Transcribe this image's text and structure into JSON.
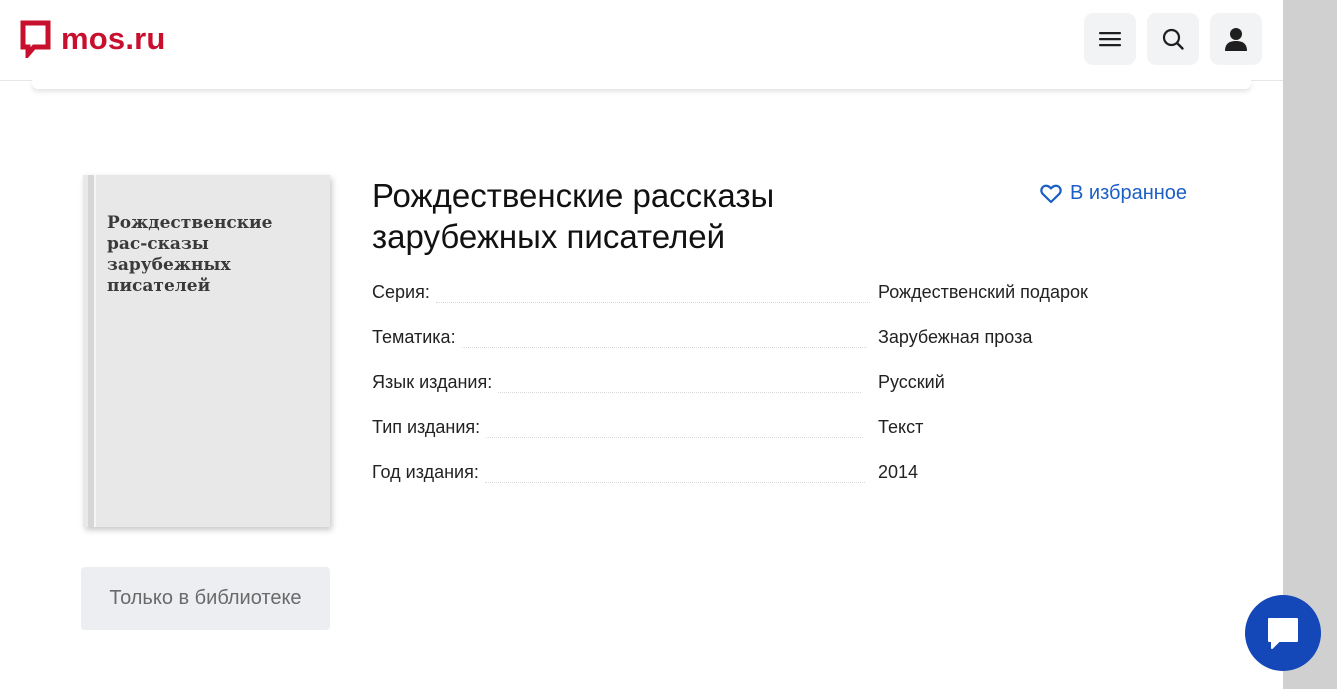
{
  "header": {
    "logo_text": "mos.ru",
    "menu_icon": "hamburger-icon",
    "search_icon": "search-icon",
    "user_icon": "user-icon",
    "brand_color": "#c8102e"
  },
  "book": {
    "cover_title": "Рождественские рас-сказы зарубежных писателей",
    "title": "Рождественские рассказы зарубежных писателей",
    "favorite_label": "В избранное",
    "availability_label": "Только в библиотеке",
    "properties": [
      {
        "key": "Серия:",
        "value": "Рождественский подарок"
      },
      {
        "key": "Тематика:",
        "value": "Зарубежная проза"
      },
      {
        "key": "Язык издания:",
        "value": "Русский"
      },
      {
        "key": "Тип издания:",
        "value": "Текст"
      },
      {
        "key": "Год издания:",
        "value": "2014"
      }
    ]
  },
  "chat": {
    "icon": "chat-icon",
    "color": "#1447b8"
  },
  "colors": {
    "accent_link": "#1c5fc4"
  }
}
